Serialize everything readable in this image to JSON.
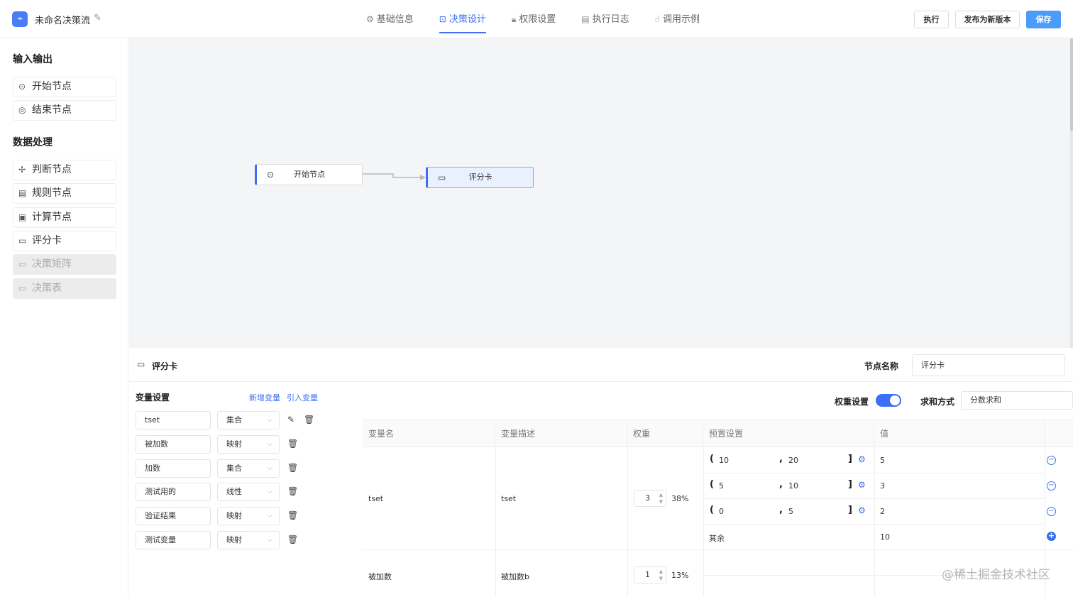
{
  "header": {
    "title": "未命名决策流",
    "tabs": [
      {
        "label": "基础信息",
        "icon": "gear-icon",
        "glyph": "⚙"
      },
      {
        "label": "决策设计",
        "icon": "design-icon",
        "glyph": "⊡"
      },
      {
        "label": "权限设置",
        "icon": "lock-icon",
        "glyph": "🔒︎"
      },
      {
        "label": "执行日志",
        "icon": "file-icon",
        "glyph": "▤"
      },
      {
        "label": "调用示例",
        "icon": "hand-icon",
        "glyph": "☝"
      }
    ],
    "buttons": {
      "run": "执行",
      "publish": "发布为新版本",
      "save": "保存"
    },
    "accent": "#3b6ff5"
  },
  "sidebar": {
    "group_io": "输入输出",
    "io_items": [
      {
        "label": "开始节点",
        "icon": "play-circle-icon"
      },
      {
        "label": "结束节点",
        "icon": "stop-circle-icon"
      }
    ],
    "group_data": "数据处理",
    "data_items": [
      {
        "label": "判断节点",
        "icon": "branch-icon"
      },
      {
        "label": "规则节点",
        "icon": "rule-icon"
      },
      {
        "label": "计算节点",
        "icon": "calculator-icon"
      },
      {
        "label": "评分卡",
        "icon": "card-icon"
      },
      {
        "label": "决策矩阵",
        "icon": "matrix-icon",
        "disabled": true
      },
      {
        "label": "决策表",
        "icon": "table-icon",
        "disabled": true
      }
    ]
  },
  "canvas": {
    "nodes": [
      {
        "label": "开始节点",
        "icon": "play-circle-icon"
      },
      {
        "label": "评分卡",
        "icon": "card-icon",
        "selected": true
      }
    ]
  },
  "panel": {
    "title": "评分卡",
    "node_name_label": "节点名称",
    "node_name_value": "评分卡",
    "var_settings": "变量设置",
    "add_var": "新增变量",
    "import_var": "引入变量",
    "weight_label": "权重设置",
    "weight_enabled": true,
    "sum_label": "求和方式",
    "sum_value": "分数求和",
    "variables": [
      {
        "name": "tset",
        "type": "集合"
      },
      {
        "name": "被加数",
        "type": "映射"
      },
      {
        "name": "加数",
        "type": "集合"
      },
      {
        "name": "测试用的",
        "type": "线性"
      },
      {
        "name": "验证结果",
        "type": "映射"
      },
      {
        "name": "测试变量",
        "type": "映射"
      }
    ],
    "table": {
      "headers": [
        "变量名",
        "变量描述",
        "权重",
        "预置设置",
        "值"
      ],
      "rows": [
        {
          "name": "tset",
          "desc": "tset",
          "weight": "3",
          "weight_pct": "38%",
          "ranges": [
            {
              "from": "10",
              "to": "20",
              "value": "5"
            },
            {
              "from": "5",
              "to": "10",
              "value": "3"
            },
            {
              "from": "0",
              "to": "5",
              "value": "2"
            }
          ],
          "else_label": "其余",
          "else_value": "10"
        },
        {
          "name": "被加数",
          "desc": "被加数b",
          "weight": "1",
          "weight_pct": "13%"
        }
      ]
    }
  },
  "watermark": "@稀土掘金技术社区"
}
